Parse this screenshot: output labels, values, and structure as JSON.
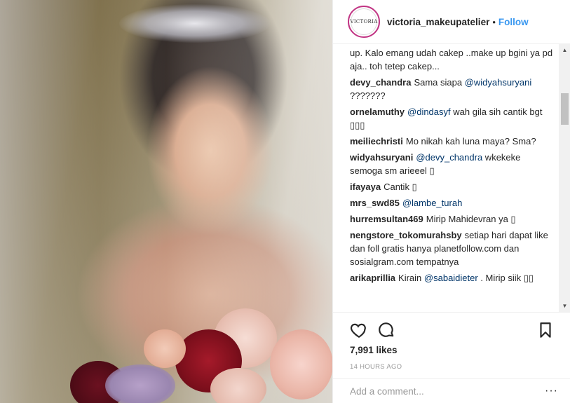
{
  "post": {
    "username": "victoria_makeupatelier",
    "avatar_text": "VICTORIA",
    "separator": "•",
    "follow_label": "Follow",
    "likes": "7,991 likes",
    "timestamp": "14 HOURS AGO",
    "add_comment_placeholder": "Add a comment...",
    "more_options": "···"
  },
  "comments": [
    {
      "user": "",
      "parts": [
        {
          "t": "up. Kalo emang udah cakep ..make up bgini ya pd aja.. toh tetep cakep..."
        }
      ]
    },
    {
      "user": "devy_chandra",
      "parts": [
        {
          "t": "Sama siapa "
        },
        {
          "m": "@widyahsuryani"
        },
        {
          "t": " ???????"
        }
      ]
    },
    {
      "user": "ornelamuthy",
      "parts": [
        {
          "m": "@dindasyf"
        },
        {
          "t": " wah gila sih cantik bgt ▯▯▯"
        }
      ]
    },
    {
      "user": "meiliechristi",
      "parts": [
        {
          "t": "Mo nikah kah luna maya? Sma?"
        }
      ]
    },
    {
      "user": "widyahsuryani",
      "parts": [
        {
          "m": "@devy_chandra"
        },
        {
          "t": " wkekeke semoga sm arieeel ▯"
        }
      ]
    },
    {
      "user": "ifayaya",
      "parts": [
        {
          "t": "Cantik ▯"
        }
      ]
    },
    {
      "user": "mrs_swd85",
      "parts": [
        {
          "m": "@lambe_turah"
        }
      ]
    },
    {
      "user": "hurremsultan469",
      "parts": [
        {
          "t": "Mirip Mahidevran ya ▯"
        }
      ]
    },
    {
      "user": "nengstore_tokomurahsby",
      "parts": [
        {
          "t": "setiap hari dapat like dan foll gratis hanya planetfollow.com dan sosialgram.com tempatnya"
        }
      ]
    },
    {
      "user": "arikaprillia",
      "parts": [
        {
          "t": "Kirain "
        },
        {
          "m": "@sabaidieter"
        },
        {
          "t": " . Mirip siik ▯▯"
        }
      ]
    }
  ],
  "icons": {
    "like": "heart-icon",
    "comment": "comment-icon",
    "save": "bookmark-icon"
  },
  "colors": {
    "follow": "#3897f0",
    "mention": "#003569",
    "avatar_ring": "#c13584"
  }
}
